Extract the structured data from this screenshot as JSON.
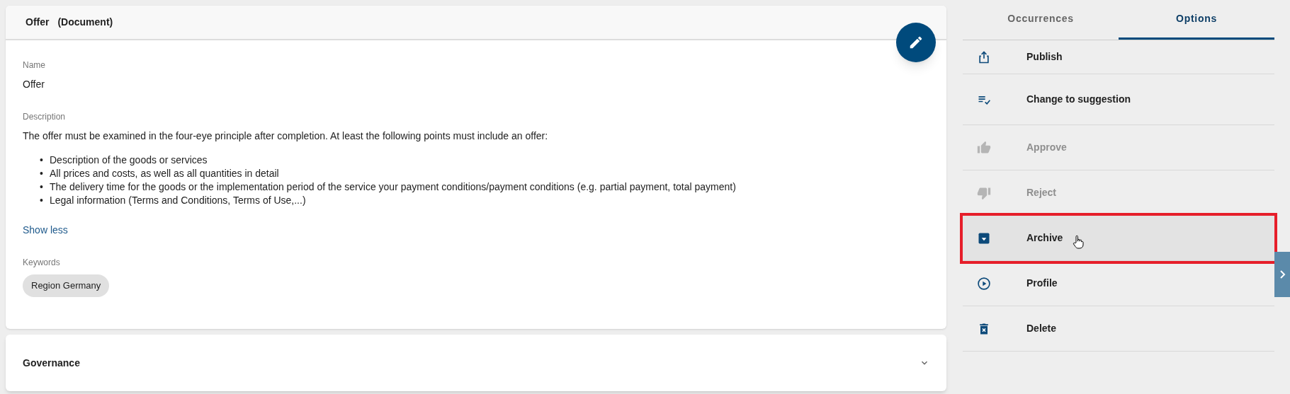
{
  "document": {
    "title": "Offer",
    "type": "(Document)",
    "fields": [
      {
        "label": "Name",
        "value": "Offer"
      },
      {
        "label": "Description",
        "value": "The offer must be examined in the four-eye principle after completion. At least the following points must include an offer:",
        "marker": "•",
        "bullets": [
          "Description of the goods or services",
          "All prices and costs, as well as all quantities in detail",
          "The delivery time for the goods or the implementation period of the service your payment conditions/payment conditions (e.g. partial payment, total payment)",
          "Legal information (Terms and Conditions, Terms of Use,...)"
        ],
        "link": "Show less"
      },
      {
        "label": "Keywords",
        "chips": [
          "Region Germany"
        ]
      }
    ]
  },
  "governance": {
    "title": "Governance",
    "expanded": false
  },
  "tabs": [
    {
      "label": "Occurrences",
      "selected": false
    },
    {
      "label": "Options",
      "selected": true
    }
  ],
  "options": [
    {
      "kind": "publish",
      "label": "Publish",
      "disabled": false,
      "highlighted": false
    },
    {
      "kind": "suggestion",
      "label": "Change to suggestion",
      "disabled": false,
      "highlighted": false
    },
    {
      "kind": "approve",
      "label": "Approve",
      "disabled": true,
      "highlighted": false
    },
    {
      "kind": "reject",
      "label": "Reject",
      "disabled": true,
      "highlighted": false
    },
    {
      "kind": "archive",
      "label": "Archive",
      "disabled": false,
      "highlighted": true
    },
    {
      "kind": "profile",
      "label": "Profile",
      "disabled": false,
      "highlighted": false
    },
    {
      "kind": "delete",
      "label": "Delete",
      "disabled": false,
      "highlighted": false
    }
  ]
}
